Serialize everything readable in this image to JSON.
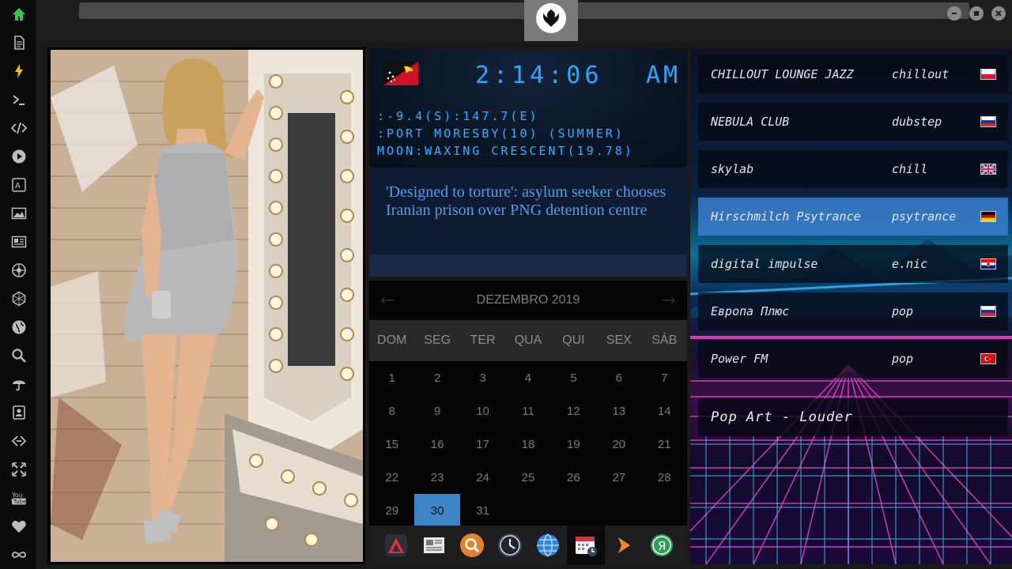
{
  "sidebar": {
    "items": [
      {
        "icon": "home-icon"
      },
      {
        "icon": "document-icon"
      },
      {
        "icon": "lightning-icon"
      },
      {
        "icon": "terminal-icon"
      },
      {
        "icon": "code-icon"
      },
      {
        "icon": "play-icon"
      },
      {
        "icon": "translate-icon"
      },
      {
        "icon": "image-icon"
      },
      {
        "icon": "news-icon"
      },
      {
        "icon": "rebel-icon"
      },
      {
        "icon": "hexagon-icon"
      },
      {
        "icon": "globe-icon"
      },
      {
        "icon": "search-icon"
      },
      {
        "icon": "umbrella-icon"
      },
      {
        "icon": "contacts-icon"
      },
      {
        "icon": "link-icon"
      },
      {
        "icon": "expand-icon"
      },
      {
        "icon": "youtube-icon"
      },
      {
        "icon": "heart-icon"
      },
      {
        "icon": "infinity-icon"
      }
    ],
    "active_color": "#3cc04f",
    "icon_color": "#bdbdbd"
  },
  "clock": {
    "time": "2:14:06",
    "ampm": "AM",
    "coords": ":-9.4(S):147.7(E)",
    "location": ":PORT MORESBY(10) (SUMMER)",
    "moon": "MOON:WAXING CRESCENT(19.78)"
  },
  "news": {
    "headline": "'Designed to torture': asylum seeker chooses Iranian prison over PNG detention centre"
  },
  "calendar": {
    "title": "DEZEMBRO 2019",
    "prev": "←",
    "next": "→",
    "weekdays": [
      "DOM",
      "SEG",
      "TER",
      "QUA",
      "QUI",
      "SEX",
      "SÁB"
    ],
    "weeks": [
      [
        "1",
        "2",
        "3",
        "4",
        "5",
        "6",
        "7"
      ],
      [
        "8",
        "9",
        "10",
        "11",
        "12",
        "13",
        "14"
      ],
      [
        "15",
        "16",
        "17",
        "18",
        "19",
        "20",
        "21"
      ],
      [
        "22",
        "23",
        "24",
        "25",
        "26",
        "27",
        "28"
      ],
      [
        "29",
        "30",
        "31",
        "",
        "",
        "",
        ""
      ]
    ],
    "selected": "30"
  },
  "dock": {
    "items": [
      {
        "icon": "launcher-icon"
      },
      {
        "icon": "newspaper-app-icon"
      },
      {
        "icon": "search-app-icon"
      },
      {
        "icon": "clock-app-icon"
      },
      {
        "icon": "browser-app-icon"
      },
      {
        "icon": "calendar-app-icon"
      },
      {
        "icon": "play-app-icon"
      },
      {
        "icon": "yandex-app-icon"
      }
    ]
  },
  "radio": {
    "stations": [
      {
        "name": "CHILLOUT LOUNGE JAZZ",
        "genre": "chillout",
        "flag": "poland"
      },
      {
        "name": "NEBULA CLUB",
        "genre": "dubstep",
        "flag": "russia"
      },
      {
        "name": "skylab",
        "genre": "chill",
        "flag": "uk"
      },
      {
        "name": "Hirschmilch Psytrance",
        "genre": "psytrance",
        "flag": "germany"
      },
      {
        "name": "digital impulse",
        "genre": "e.nic",
        "flag": "croatia"
      },
      {
        "name": "Европа Плюс",
        "genre": "pop",
        "flag": "russia"
      },
      {
        "name": "Power FM",
        "genre": "pop",
        "flag": "turkey"
      }
    ],
    "active_index": 3,
    "now_playing": "Pop Art - Louder"
  }
}
